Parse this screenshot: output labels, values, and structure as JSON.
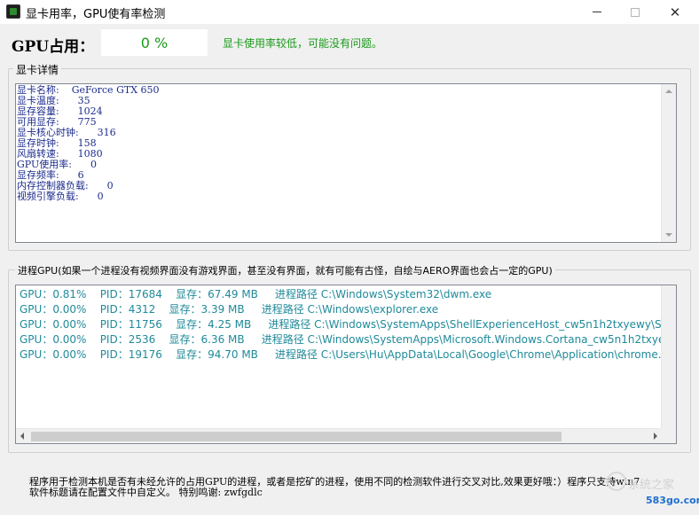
{
  "window": {
    "title": "显卡用率，GPU使有率检测",
    "close_glyph": "✕"
  },
  "gpu_usage": {
    "label": "GPU占用：",
    "value": "0 %",
    "message": "显卡使用率较低，可能没有问题。"
  },
  "details": {
    "legend": "显卡详情",
    "lines": [
      "显卡名称:    GeForce GTX 650",
      "显卡温度:      35",
      "显存容量:      1024",
      "可用显存:      775",
      "显卡核心时钟:      316",
      "显存时钟:      158",
      "风扇转速:      1080",
      "GPU使用率:      0",
      "显存频率:      6",
      "内存控制器负载:      0",
      "视频引擎负载:      0"
    ]
  },
  "processes": {
    "legend": "进程GPU(如果一个进程没有视频界面没有游戏界面，甚至没有界面，就有可能有古怪，自绘与AERO界面也会占一定的GPU)",
    "rows": [
      "GPU：0.81%    PID：17684    显存：67.49 MB     进程路径 C:\\Windows\\System32\\dwm.exe",
      "GPU：0.00%    PID：4312    显存：3.39 MB     进程路径 C:\\Windows\\explorer.exe",
      "GPU：0.00%    PID：11756    显存：4.25 MB     进程路径 C:\\Windows\\SystemApps\\ShellExperienceHost_cw5n1h2txyewy\\Shell",
      "GPU：0.00%    PID：2536    显存：6.36 MB     进程路径 C:\\Windows\\SystemApps\\Microsoft.Windows.Cortana_cw5n1h2txyewy",
      "GPU：0.00%    PID：19176    显存：94.70 MB     进程路径 C:\\Users\\Hu\\AppData\\Local\\Google\\Chrome\\Application\\chrome.e"
    ]
  },
  "footer": {
    "line1": "程序用于检测本机是否有未经允许的占用GPU的进程，或者是挖矿的进程，使用不同的检测软件进行交叉对比,效果更好哦：）程序只支持win7",
    "line2": "软件标题请在配置文件中自定义。 特别鸣谢: zwfgdlc"
  },
  "watermark": {
    "logo_text": "系统之家",
    "site": "583go.com"
  },
  "colors": {
    "green": "#1a9a1a",
    "process_text": "#1f8a9a",
    "details_text": "#1b2b8c"
  }
}
